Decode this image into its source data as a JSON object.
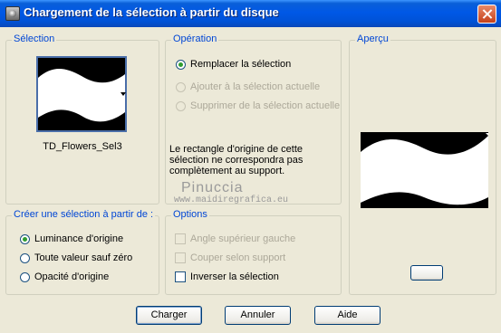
{
  "window": {
    "title": "Chargement de la sélection à partir du disque"
  },
  "selection_group": {
    "legend": "Sélection",
    "file_name": "TD_Flowers_Sel3"
  },
  "operation_group": {
    "legend": "Opération",
    "options": [
      {
        "label": "Remplacer la sélection",
        "selected": true,
        "enabled": true
      },
      {
        "label": "Ajouter à la sélection actuelle",
        "selected": false,
        "enabled": false
      },
      {
        "label": "Supprimer de la sélection actuelle",
        "selected": false,
        "enabled": false
      }
    ],
    "note": "Le rectangle d'origine de cette sélection ne correspondra pas complètement au support."
  },
  "preview_group": {
    "legend": "Aperçu"
  },
  "create_group": {
    "legend": "Créer une sélection à partir de :",
    "options": [
      {
        "label": "Luminance d'origine",
        "selected": true
      },
      {
        "label": "Toute valeur sauf zéro",
        "selected": false
      },
      {
        "label": "Opacité d'origine",
        "selected": false
      }
    ]
  },
  "options_group": {
    "legend": "Options",
    "items": [
      {
        "label": "Angle supérieur gauche",
        "checked": false,
        "enabled": false
      },
      {
        "label": "Couper selon support",
        "checked": false,
        "enabled": false
      },
      {
        "label": "Inverser la sélection",
        "checked": false,
        "enabled": true
      }
    ]
  },
  "watermark": {
    "line1": "Pinuccia",
    "line2": "www.maidiregrafica.eu"
  },
  "buttons": {
    "load": "Charger",
    "cancel": "Annuler",
    "help": "Aide"
  },
  "colors": {
    "legend": "#0046d5",
    "title_bar": "#0058e6",
    "face": "#ece9d8"
  }
}
